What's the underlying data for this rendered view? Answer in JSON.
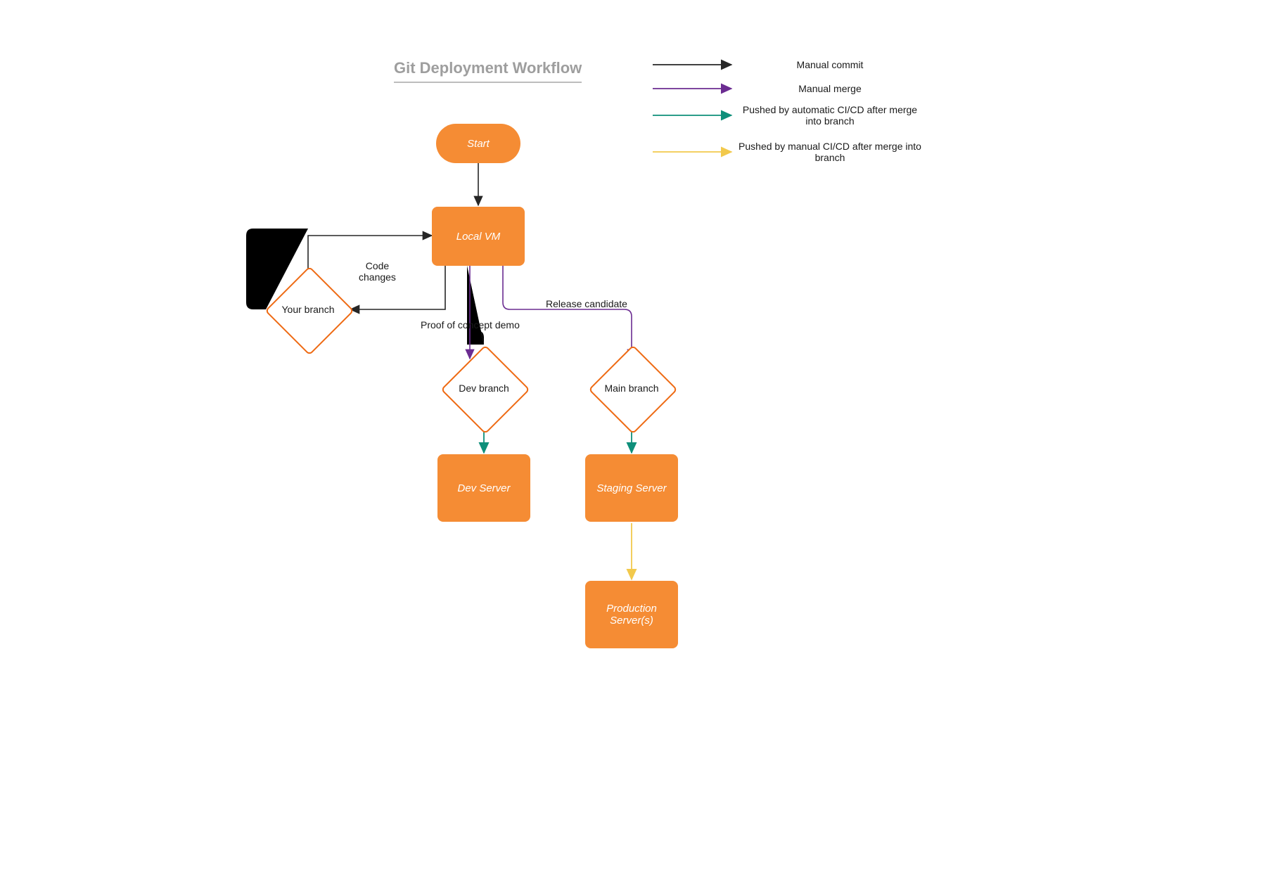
{
  "title": "Git Deployment Workflow",
  "nodes": {
    "start": "Start",
    "local_vm": "Local VM",
    "your_branch": "Your branch",
    "dev_branch": "Dev branch",
    "main_branch": "Main branch",
    "dev_server": "Dev Server",
    "staging_server": "Staging Server",
    "production_server": "Production\nServer(s)"
  },
  "edge_labels": {
    "code_changes": "Code\nchanges",
    "proof_of_concept": "Proof of concept demo",
    "release_candidate": "Release candidate"
  },
  "legend": {
    "manual_commit": "Manual commit",
    "manual_merge": "Manual merge",
    "auto_cicd": "Pushed by automatic CI/CD after merge into branch",
    "manual_cicd": "Pushed by manual CI/CD after merge into branch"
  },
  "colors": {
    "black": "#262626",
    "purple": "#6b2c91",
    "teal": "#0e8f7a",
    "yellow": "#f2c94c",
    "orangeFill": "#f58c34",
    "orangeStroke": "#ee6a13"
  }
}
